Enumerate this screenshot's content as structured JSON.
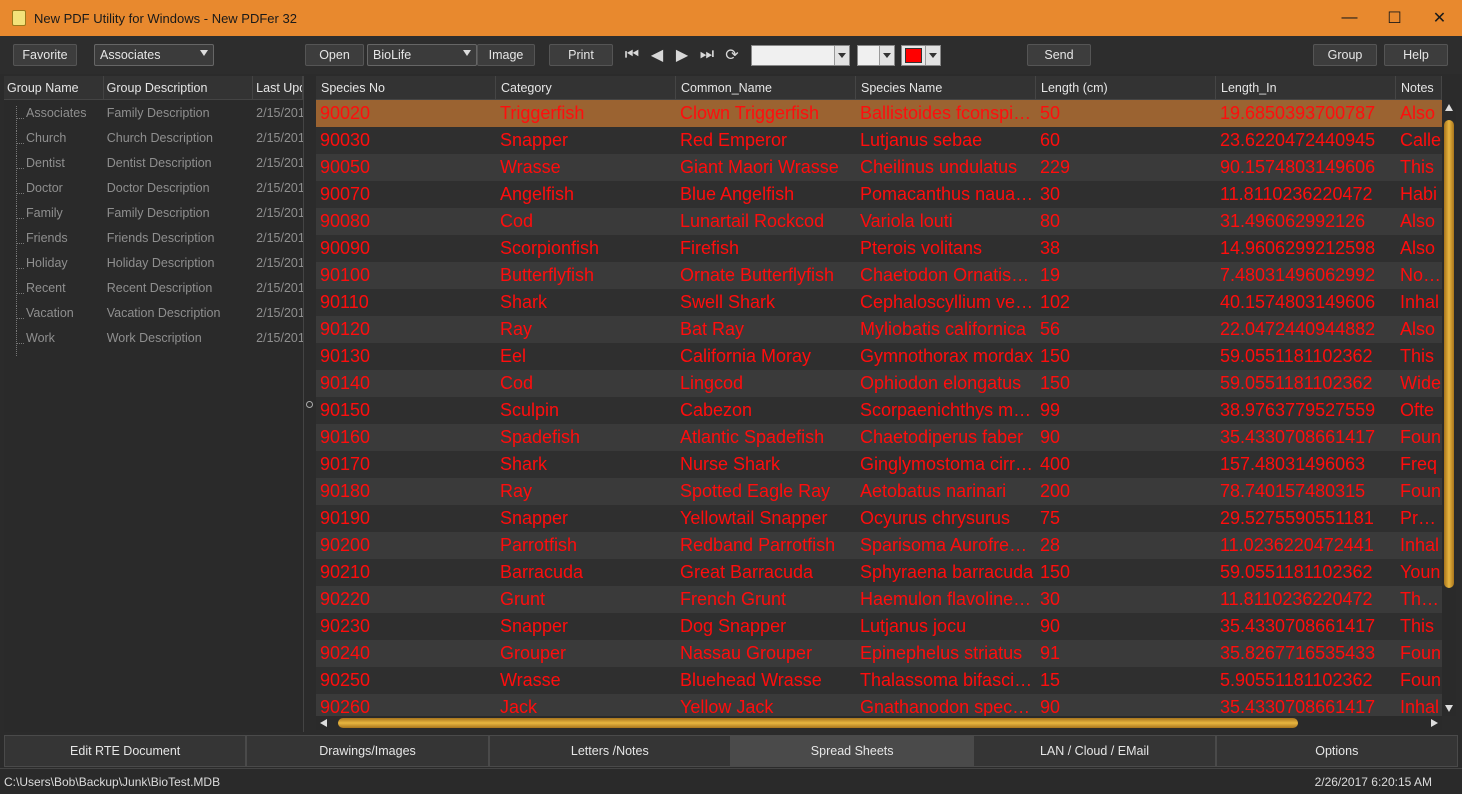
{
  "window": {
    "title": "New PDF Utility for Windows - New PDFer 32",
    "minimize": "—",
    "maximize": "☐",
    "close": "✕"
  },
  "toolbar": {
    "favorite": "Favorite",
    "group_select": "Associates",
    "open": "Open",
    "db_select": "BioLife",
    "image": "Image",
    "print": "Print",
    "color_swatch": "#ff0000",
    "send": "Send",
    "group": "Group",
    "help": "Help"
  },
  "nav": {
    "first": "⏮",
    "prev": "◀",
    "next": "▶",
    "last": "⏭",
    "refresh": "⟳"
  },
  "left_panel": {
    "headers": [
      "Group Name",
      "Group Description",
      "Last Upd"
    ],
    "rows": [
      {
        "name": "Associates",
        "desc": "Family Description",
        "date": "2/15/201"
      },
      {
        "name": "Church",
        "desc": "Church Description",
        "date": "2/15/201"
      },
      {
        "name": "Dentist",
        "desc": "Dentist Description",
        "date": "2/15/201"
      },
      {
        "name": "Doctor",
        "desc": "Doctor Description",
        "date": "2/15/201"
      },
      {
        "name": "Family",
        "desc": "Family Description",
        "date": "2/15/201"
      },
      {
        "name": "Friends",
        "desc": "Friends Description",
        "date": "2/15/201"
      },
      {
        "name": "Holiday",
        "desc": "Holiday Description",
        "date": "2/15/201"
      },
      {
        "name": "Recent",
        "desc": "Recent Description",
        "date": "2/15/201"
      },
      {
        "name": "Vacation",
        "desc": "Vacation Description",
        "date": "2/15/201"
      },
      {
        "name": "Work",
        "desc": "Work Description",
        "date": "2/15/201"
      }
    ]
  },
  "grid": {
    "headers": [
      "Species No",
      "Category",
      "Common_Name",
      "Species Name",
      "Length (cm)",
      "Length_In",
      "Notes"
    ],
    "rows": [
      [
        "90020",
        "Triggerfish",
        "Clown Triggerfish",
        "Ballistoides fconspi…",
        "50",
        "19.6850393700787",
        "Also"
      ],
      [
        "90030",
        "Snapper",
        "Red Emperor",
        "Lutjanus sebae",
        "60",
        "23.6220472440945",
        "Calle"
      ],
      [
        "90050",
        "Wrasse",
        "Giant Maori Wrasse",
        "Cheilinus undulatus",
        "229",
        "90.1574803149606",
        "This"
      ],
      [
        "90070",
        "Angelfish",
        "Blue Angelfish",
        "Pomacanthus naua…",
        "30",
        "11.8110236220472",
        "Habi"
      ],
      [
        "90080",
        "Cod",
        "Lunartail Rockcod",
        "Variola louti",
        "80",
        "31.496062992126",
        "Also"
      ],
      [
        "90090",
        "Scorpionfish",
        "Firefish",
        "Pterois volitans",
        "38",
        "14.9606299212598",
        "Also"
      ],
      [
        "90100",
        "Butterflyfish",
        "Ornate Butterflyfish",
        "Chaetodon Ornatis…",
        "19",
        "7.48031496062992",
        "Norm"
      ],
      [
        "90110",
        "Shark",
        "Swell Shark",
        "Cephaloscyllium ve…",
        "102",
        "40.1574803149606",
        "Inhal"
      ],
      [
        "90120",
        "Ray",
        "Bat Ray",
        "Myliobatis californica",
        "56",
        "22.0472440944882",
        "Also"
      ],
      [
        "90130",
        "Eel",
        "California Moray",
        "Gymnothorax mordax",
        "150",
        "59.0551181102362",
        "This"
      ],
      [
        "90140",
        "Cod",
        "Lingcod",
        "Ophiodon elongatus",
        "150",
        "59.0551181102362",
        "Wide"
      ],
      [
        "90150",
        "Sculpin",
        "Cabezon",
        "Scorpaenichthys m…",
        "99",
        "38.9763779527559",
        "Ofte"
      ],
      [
        "90160",
        "Spadefish",
        "Atlantic Spadefish",
        "Chaetodiperus faber",
        "90",
        "35.4330708661417",
        "Foun"
      ],
      [
        "90170",
        "Shark",
        "Nurse Shark",
        "Ginglymostoma cirr…",
        "400",
        "157.48031496063",
        "Freq"
      ],
      [
        "90180",
        "Ray",
        "Spotted Eagle Ray",
        "Aetobatus narinari",
        "200",
        "78.740157480315",
        "Foun"
      ],
      [
        "90190",
        "Snapper",
        "Yellowtail Snapper",
        "Ocyurus chrysurus",
        "75",
        "29.5275590551181",
        "Prefe"
      ],
      [
        "90200",
        "Parrotfish",
        "Redband Parrotfish",
        "Sparisoma Aurofre…",
        "28",
        "11.0236220472441",
        "Inhal"
      ],
      [
        "90210",
        "Barracuda",
        "Great Barracuda",
        "Sphyraena barracuda",
        "150",
        "59.0551181102362",
        "Youn"
      ],
      [
        "90220",
        "Grunt",
        "French Grunt",
        "Haemulon flavoline…",
        "30",
        "11.8110236220472",
        "The F"
      ],
      [
        "90230",
        "Snapper",
        "Dog Snapper",
        "Lutjanus jocu",
        "90",
        "35.4330708661417",
        "This"
      ],
      [
        "90240",
        "Grouper",
        "Nassau Grouper",
        "Epinephelus striatus",
        "91",
        "35.8267716535433",
        "Foun"
      ],
      [
        "90250",
        "Wrasse",
        "Bluehead Wrasse",
        "Thalassoma bifasci…",
        "15",
        "5.90551181102362",
        "Foun"
      ],
      [
        "90260",
        "Jack",
        "Yellow Jack",
        "Gnathanodon spec…",
        "90",
        "35.4330708661417",
        "Inhal"
      ]
    ]
  },
  "tabs": [
    "Edit RTE Document",
    "Drawings/Images",
    "Letters /Notes",
    "Spread Sheets",
    "LAN / Cloud / EMail",
    "Options"
  ],
  "status": {
    "path": "C:\\Users\\Bob\\Backup\\Junk\\BioTest.MDB",
    "time": "2/26/2017 6:20:15 AM"
  }
}
